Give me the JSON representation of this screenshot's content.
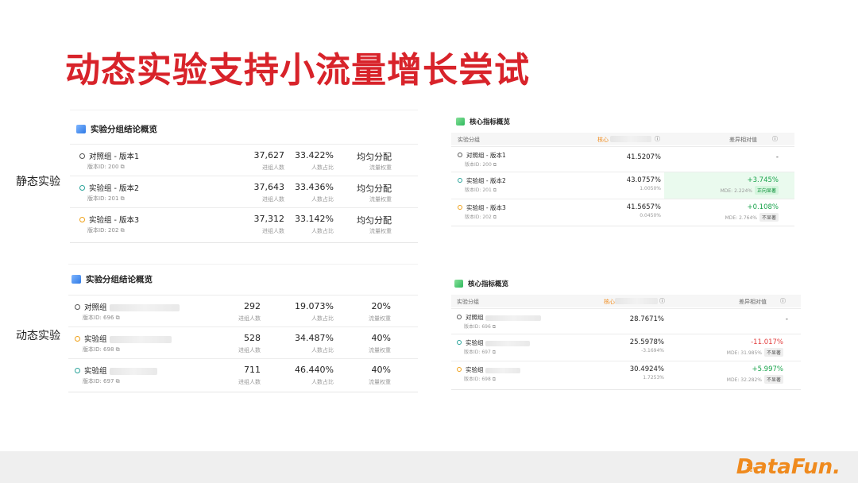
{
  "title": "动态实验支持小流量增长尝试",
  "labels": {
    "static": "静态实验",
    "dynamic": "动态实验"
  },
  "static_summary": {
    "header": "实验分组结论概览",
    "rows": [
      {
        "name": "对照组 - 版本1",
        "id": "版本ID: 200",
        "count": "37,627",
        "count_cap": "进组人数",
        "pct": "33.422%",
        "pct_cap": "人数占比",
        "alloc": "均匀分配",
        "alloc_cap": "流量权重",
        "dot": "#555555"
      },
      {
        "name": "实验组 - 版本2",
        "id": "版本ID: 201",
        "count": "37,643",
        "count_cap": "进组人数",
        "pct": "33.436%",
        "pct_cap": "人数占比",
        "alloc": "均匀分配",
        "alloc_cap": "流量权重",
        "dot": "#2aa39a"
      },
      {
        "name": "实验组 - 版本3",
        "id": "版本ID: 202",
        "count": "37,312",
        "count_cap": "进组人数",
        "pct": "33.142%",
        "pct_cap": "人数占比",
        "alloc": "均匀分配",
        "alloc_cap": "流量权重",
        "dot": "#f0a21a"
      }
    ]
  },
  "static_metrics": {
    "header": "核心指标概览",
    "col_group": "实验分组",
    "col_core": "核心",
    "col_diff": "差异相对值",
    "rows": [
      {
        "name": "对照组 - 版本1",
        "id": "版本ID: 200",
        "value": "41.5207%",
        "sub": "",
        "diff": "-",
        "mde": "",
        "tag": ""
      },
      {
        "name": "实验组 - 版本2",
        "id": "版本ID: 201",
        "value": "43.0757%",
        "sub": "1.0050%",
        "diff": "+3.745%",
        "mde": "MDE: 2.224%",
        "tag": "正向显著"
      },
      {
        "name": "实验组 - 版本3",
        "id": "版本ID: 202",
        "value": "41.5657%",
        "sub": "0.0450%",
        "diff": "+0.108%",
        "mde": "MDE: 2.764%",
        "tag": "不显著"
      }
    ]
  },
  "dynamic_summary": {
    "header": "实验分组结论概览",
    "rows": [
      {
        "name": "对照组",
        "id": "版本ID: 696",
        "count": "292",
        "count_cap": "进组人数",
        "pct": "19.073%",
        "pct_cap": "人数占比",
        "alloc": "20%",
        "alloc_cap": "流量权重",
        "dot": "#555555"
      },
      {
        "name": "实验组",
        "id": "版本ID: 698",
        "count": "528",
        "count_cap": "进组人数",
        "pct": "34.487%",
        "pct_cap": "人数占比",
        "alloc": "40%",
        "alloc_cap": "流量权重",
        "dot": "#f0a21a"
      },
      {
        "name": "实验组",
        "id": "版本ID: 697",
        "count": "711",
        "count_cap": "进组人数",
        "pct": "46.440%",
        "pct_cap": "人数占比",
        "alloc": "40%",
        "alloc_cap": "流量权重",
        "dot": "#2aa39a"
      }
    ]
  },
  "dynamic_metrics": {
    "header": "核心指标概览",
    "col_group": "实验分组",
    "col_core": "核心",
    "col_diff": "差异相对值",
    "rows": [
      {
        "name": "对照组",
        "id": "版本ID: 696",
        "value": "28.7671%",
        "sub": "",
        "diff": "-",
        "mde": "",
        "tag": ""
      },
      {
        "name": "实验组",
        "id": "版本ID: 697",
        "value": "25.5978%",
        "sub": "-3.1694%",
        "diff": "-11.017%",
        "mde": "MDE: 31.985%",
        "tag": "不显著"
      },
      {
        "name": "实验组",
        "id": "版本ID: 698",
        "value": "30.4924%",
        "sub": "1.7253%",
        "diff": "+5.997%",
        "mde": "MDE: 32.282%",
        "tag": "不显著"
      }
    ]
  },
  "footer": {
    "logo": "DataFun."
  }
}
